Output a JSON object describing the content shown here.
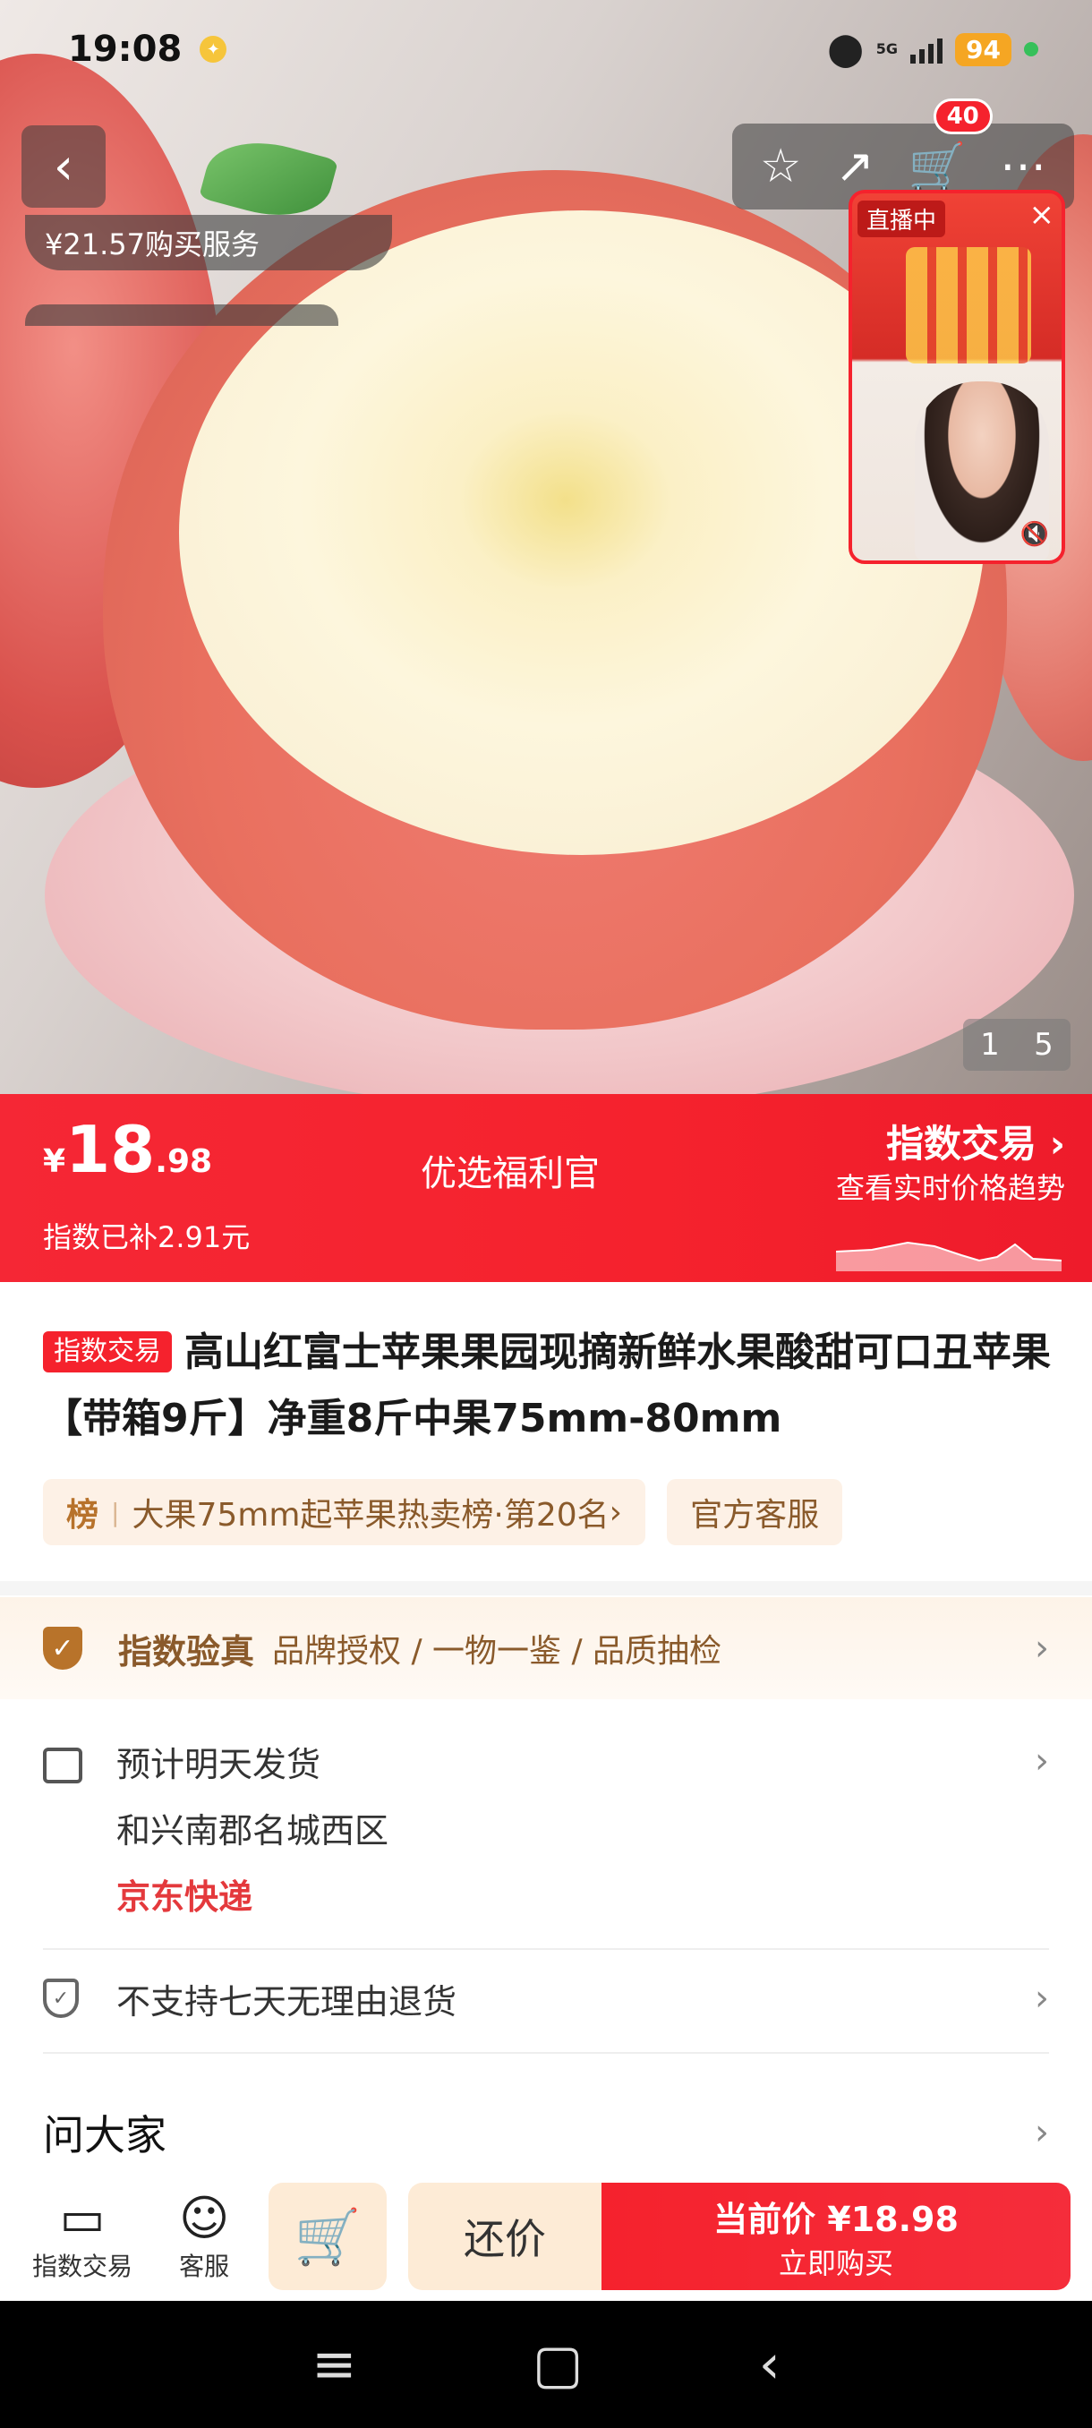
{
  "status_bar": {
    "time": "19:08",
    "network": "5G",
    "battery": "94"
  },
  "header": {
    "cart_count": "40"
  },
  "hero": {
    "coupon_text": "¥21.57购买服务",
    "live_tag": "直播中",
    "image_index": "1",
    "image_total": "5"
  },
  "price": {
    "currency": "¥",
    "integer": "18",
    "decimal": ".98",
    "subsidy": "指数已补2.91元",
    "center_label": "优选福利官",
    "index_title": "指数交易",
    "index_sub": "查看实时价格趋势"
  },
  "product": {
    "tag": "指数交易",
    "title": "高山红富士苹果果园现摘新鲜水果酸甜可口丑苹果 【带箱9斤】净重8斤中果75mm-80mm",
    "rank_badge": "榜",
    "rank_text": "大果75mm起苹果热卖榜·第20名",
    "service_chip": "官方客服"
  },
  "verify": {
    "title": "指数验真",
    "items": "品牌授权 / 一物一鉴 / 品质抽检"
  },
  "shipping": {
    "eta": "预计明天发货",
    "address": "和兴南郡名城西区",
    "carrier": "京东快递"
  },
  "returns": {
    "text": "不支持七天无理由退货"
  },
  "ask": {
    "title": "问大家"
  },
  "bottom": {
    "index_label": "指数交易",
    "service_label": "客服",
    "bargain_label": "还价",
    "buy_price": "当前价 ¥18.98",
    "buy_label": "立即购买"
  },
  "colors": {
    "brand_red": "#f5222d",
    "gold": "#8a5a2b"
  }
}
